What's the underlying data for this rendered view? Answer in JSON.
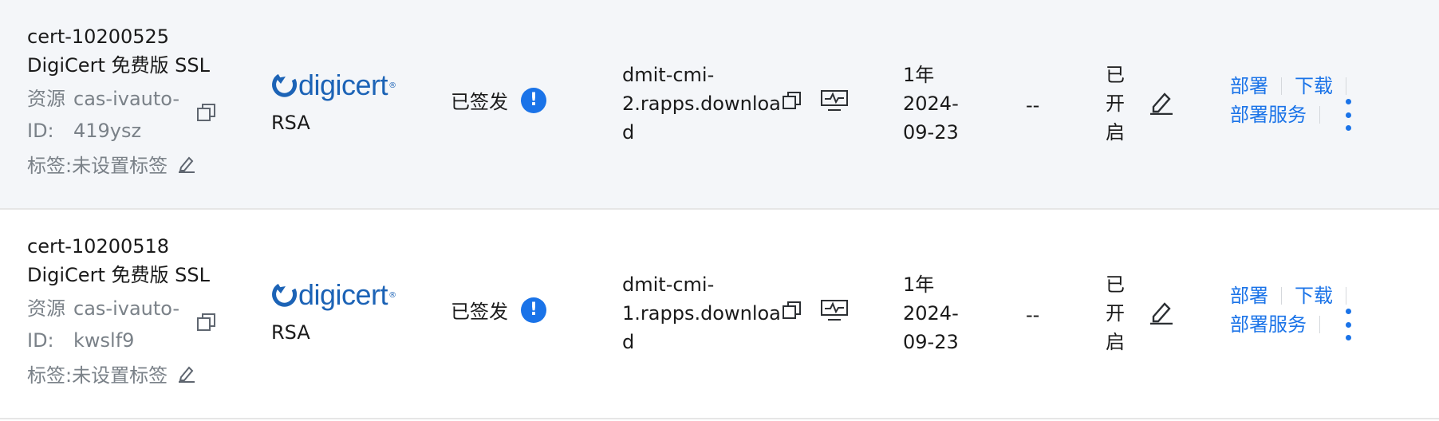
{
  "rows": [
    {
      "id": "cert-10200525",
      "name": "DigiCert 免费版 SSL",
      "resource_label": "资源",
      "resource_id_label": "ID:",
      "resource_val_1": "cas-ivauto-",
      "resource_val_2": "419ysz",
      "tag_text": "标签:未设置标签",
      "brand": "digicert",
      "algorithm": "RSA",
      "status": "已签发",
      "status_icon": "!",
      "domain_lines": [
        "dmit-cmi-",
        "2.rapps.downloa",
        "d"
      ],
      "validity_lines": [
        "1年",
        "2024-",
        "09-23"
      ],
      "extra": "--",
      "auto_renew_lines": [
        "已",
        "开",
        "启"
      ],
      "ops": {
        "deploy": "部署",
        "download": "下载",
        "deploy_service": "部署服务"
      }
    },
    {
      "id": "cert-10200518",
      "name": "DigiCert 免费版 SSL",
      "resource_label": "资源",
      "resource_id_label": "ID:",
      "resource_val_1": "cas-ivauto-",
      "resource_val_2": "kwslf9",
      "tag_text": "标签:未设置标签",
      "brand": "digicert",
      "algorithm": "RSA",
      "status": "已签发",
      "status_icon": "!",
      "domain_lines": [
        "dmit-cmi-",
        "1.rapps.downloa",
        "d"
      ],
      "validity_lines": [
        "1年",
        "2024-",
        "09-23"
      ],
      "extra": "--",
      "auto_renew_lines": [
        "已",
        "开",
        "启"
      ],
      "ops": {
        "deploy": "部署",
        "download": "下载",
        "deploy_service": "部署服务"
      }
    }
  ],
  "colors": {
    "link": "#1a73e8",
    "muted": "#7a8188",
    "brand": "#1c63b6",
    "row_hover": "#f4f6f9"
  }
}
